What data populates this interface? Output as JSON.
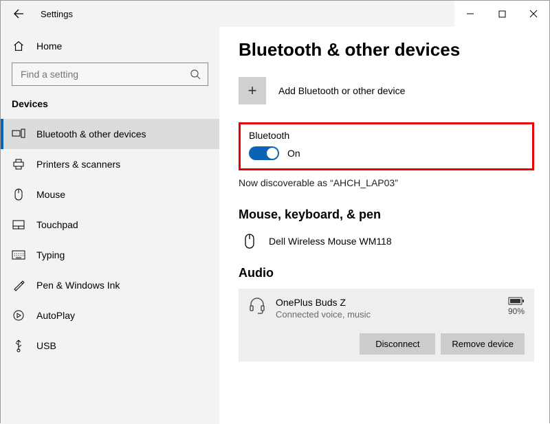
{
  "titlebar": {
    "title": "Settings"
  },
  "home_label": "Home",
  "search": {
    "placeholder": "Find a setting"
  },
  "category_label": "Devices",
  "nav": [
    {
      "label": "Bluetooth & other devices"
    },
    {
      "label": "Printers & scanners"
    },
    {
      "label": "Mouse"
    },
    {
      "label": "Touchpad"
    },
    {
      "label": "Typing"
    },
    {
      "label": "Pen & Windows Ink"
    },
    {
      "label": "AutoPlay"
    },
    {
      "label": "USB"
    }
  ],
  "page_title": "Bluetooth & other devices",
  "add_label": "Add Bluetooth or other device",
  "bluetooth": {
    "heading": "Bluetooth",
    "state_text": "On",
    "discoverable_text": "Now discoverable as “AHCH_LAP03”"
  },
  "mkp": {
    "heading": "Mouse, keyboard, & pen",
    "device_name": "Dell Wireless Mouse WM118"
  },
  "audio": {
    "heading": "Audio",
    "device_name": "OnePlus Buds Z",
    "device_sub": "Connected voice, music",
    "battery_text": "90%",
    "disconnect_label": "Disconnect",
    "remove_label": "Remove device"
  }
}
